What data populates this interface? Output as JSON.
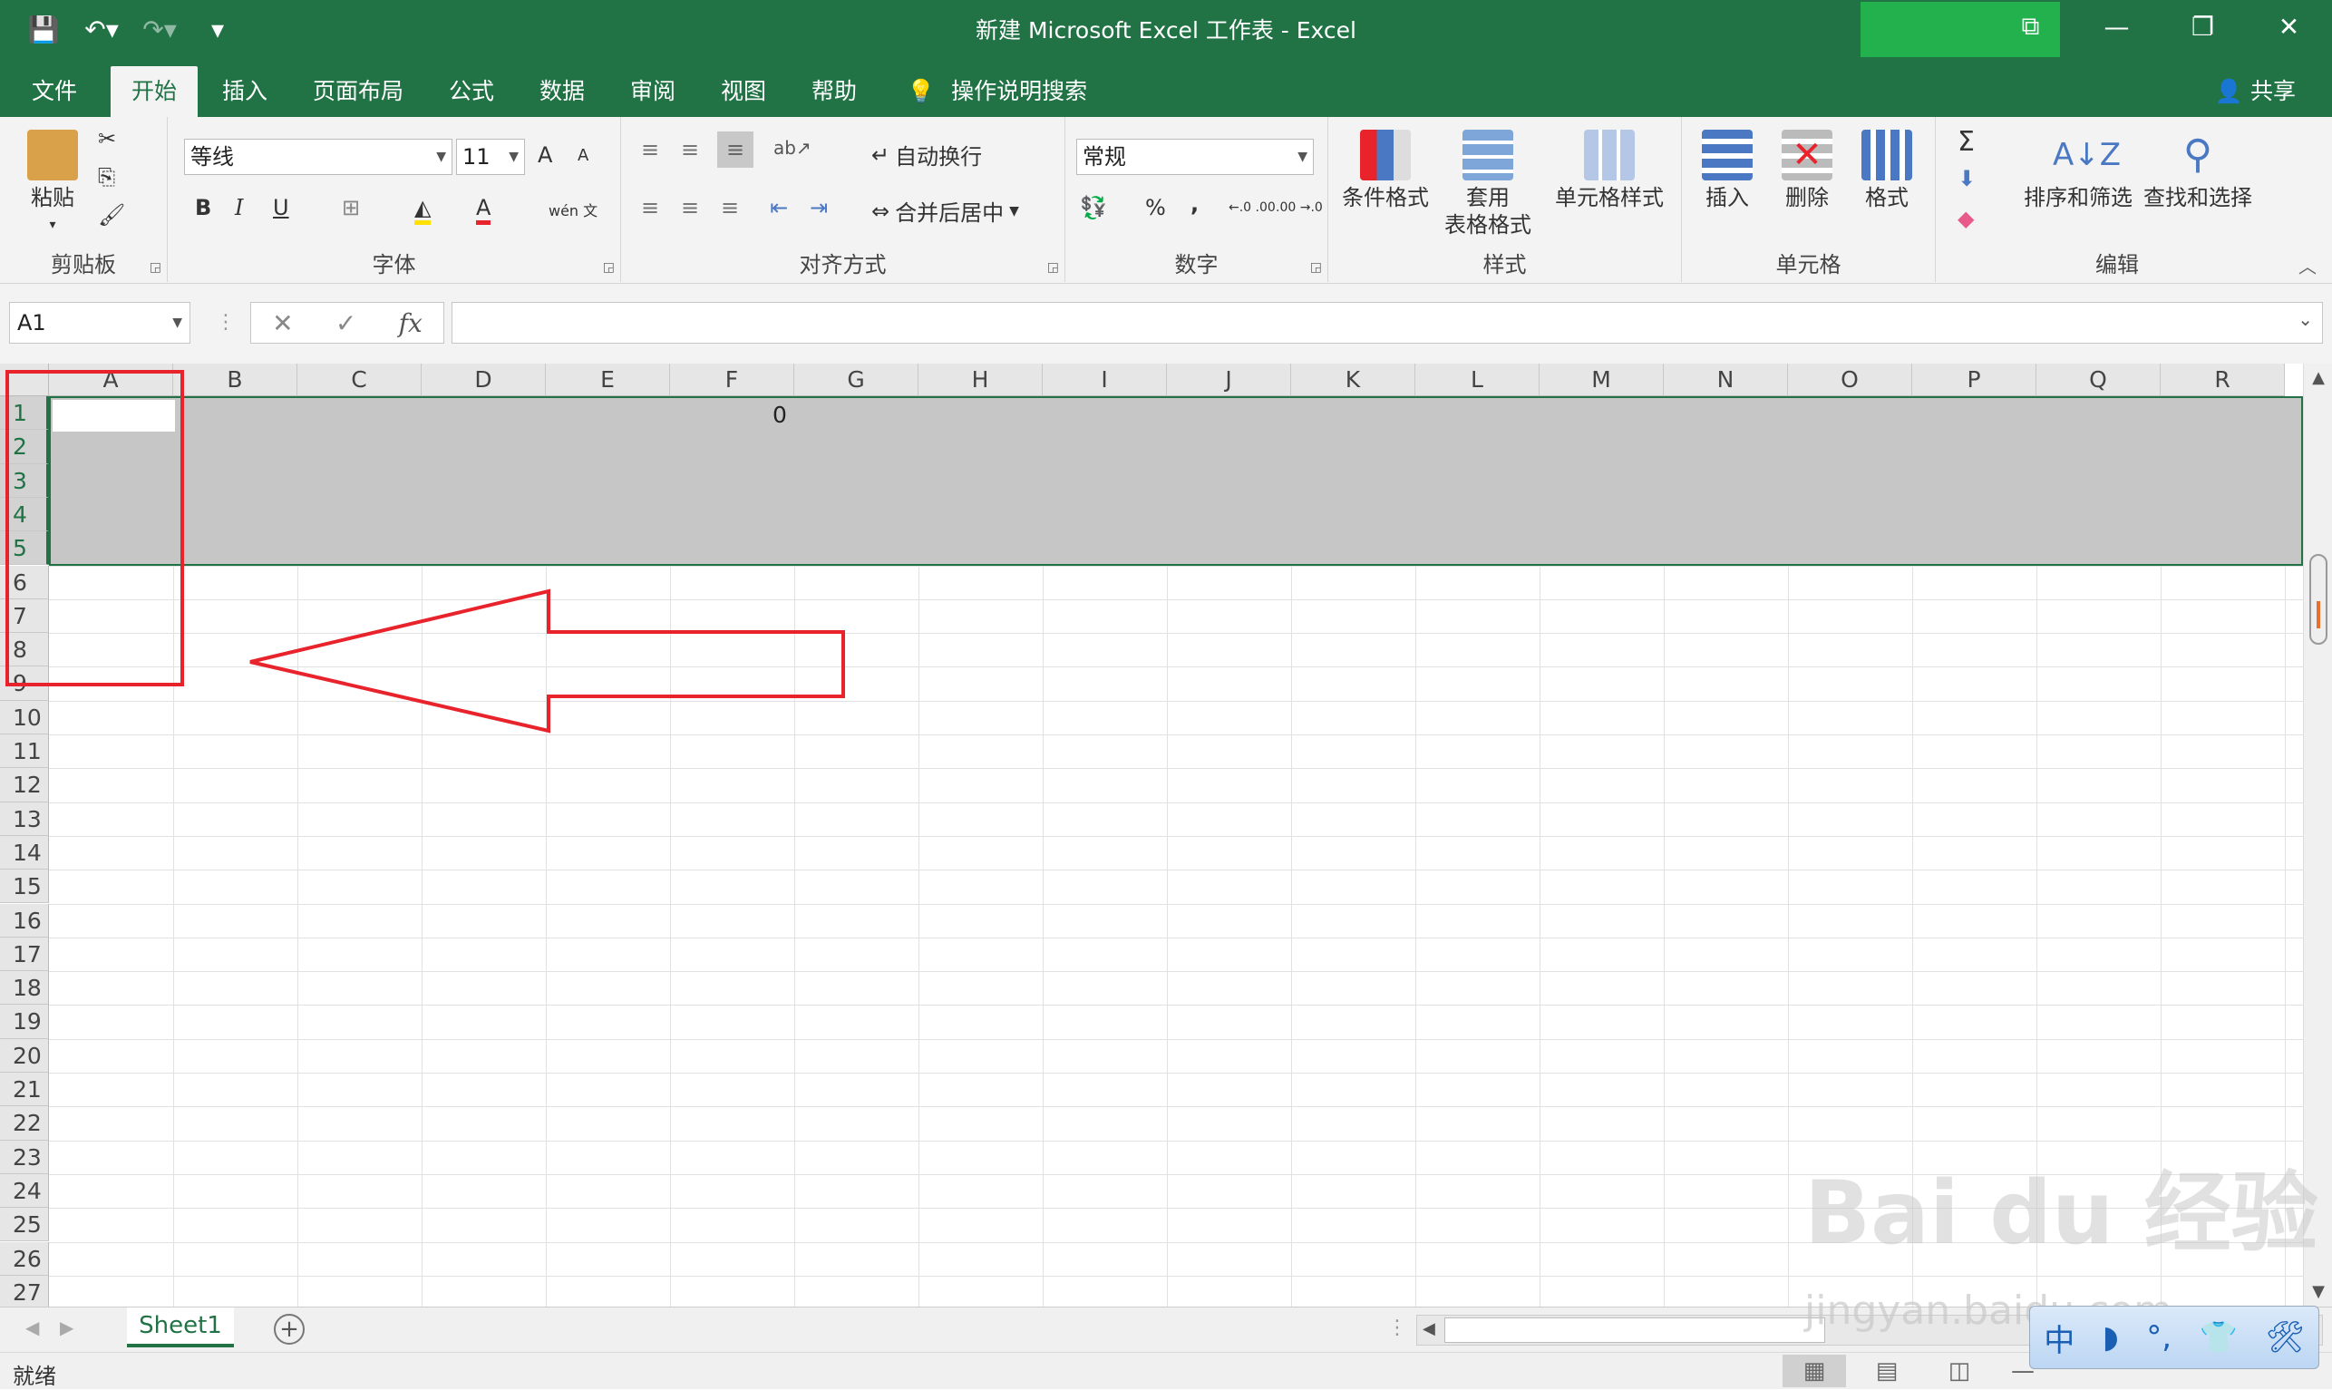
{
  "title": "新建 Microsoft Excel 工作表  -  Excel",
  "qat": {
    "save": "💾",
    "undo": "↶▾",
    "redo": "↷▾",
    "more": "▾"
  },
  "window_controls": {
    "ribbon_display": "⧉",
    "minimize": "—",
    "restore": "❐",
    "close": "✕"
  },
  "tabs": [
    "文件",
    "开始",
    "插入",
    "页面布局",
    "公式",
    "数据",
    "审阅",
    "视图",
    "帮助"
  ],
  "active_tab": "开始",
  "tell_me": {
    "icon": "💡",
    "text": "操作说明搜索"
  },
  "share": "共享",
  "ribbon": {
    "clipboard": {
      "label": "剪贴板",
      "paste": "粘贴",
      "paste_dd": "▾",
      "cut": "✂",
      "copy": "⎘",
      "painter": "🖌"
    },
    "font": {
      "label": "字体",
      "family": "等线",
      "size": "11",
      "grow": "A",
      "shrink": "A",
      "bold": "B",
      "italic": "I",
      "underline": "U",
      "border": "⊞",
      "fill": "◭",
      "color": "A",
      "phonetic": "wén 文"
    },
    "alignment": {
      "label": "对齐方式",
      "wrap": "自动换行",
      "merge": "合并后居中",
      "orientation": "ab↗"
    },
    "number": {
      "label": "数字",
      "format": "常规",
      "currency": "💱",
      "percent": "%",
      "comma": ",",
      "inc_dec": "←.0 .00",
      "dec_dec": ".00 →.0"
    },
    "styles": {
      "label": "样式",
      "conditional": "条件格式",
      "table1": "套用",
      "table2": "表格格式",
      "cell_styles": "单元格样式"
    },
    "cells": {
      "label": "单元格",
      "insert": "插入",
      "delete": "删除",
      "format": "格式"
    },
    "editing": {
      "label": "编辑",
      "autosum": "Σ",
      "fill": "⬇",
      "clear": "◆",
      "sort": "排序和筛选",
      "find": "查找和选择"
    }
  },
  "namebox": "A1",
  "formula_buttons": {
    "cancel": "✕",
    "enter": "✓",
    "fx": "fx"
  },
  "formula_value": "",
  "columns": [
    "A",
    "B",
    "C",
    "D",
    "E",
    "F",
    "G",
    "H",
    "I",
    "J",
    "K",
    "L",
    "M",
    "N",
    "O",
    "P",
    "Q",
    "R"
  ],
  "rows": [
    "1",
    "2",
    "3",
    "4",
    "5",
    "6",
    "7",
    "8",
    "9",
    "10",
    "11",
    "12",
    "13",
    "14",
    "15",
    "16",
    "17",
    "18",
    "19",
    "20",
    "21",
    "22",
    "23",
    "24",
    "25",
    "26",
    "27"
  ],
  "selected_rows": [
    "1",
    "2",
    "3",
    "4",
    "5"
  ],
  "cell_F1": "0",
  "sheet_tab": "Sheet1",
  "add_sheet": "+",
  "status": "就绪",
  "watermark": {
    "text": "Bai du 经验",
    "url": "jingyan.baidu.com"
  },
  "ime": {
    "items": [
      "中",
      "◗",
      "°,",
      "👕",
      "🛠"
    ]
  },
  "colors": {
    "accent": "#217346",
    "annotation": "#e8232b"
  }
}
